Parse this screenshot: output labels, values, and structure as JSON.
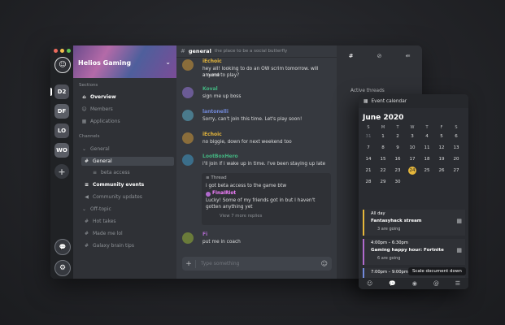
{
  "window": {
    "dots": [
      "#ed6a5e",
      "#f4bf4f",
      "#61c554"
    ]
  },
  "rail": {
    "servers": [
      {
        "initials": "D2"
      },
      {
        "initials": "DF"
      },
      {
        "initials": "LO"
      },
      {
        "initials": "WO"
      }
    ],
    "add": "+",
    "chat": "💬",
    "settings": "⚙"
  },
  "sidebar": {
    "guild_name": "Helios Gaming",
    "sections_title": "Sections",
    "sections": [
      {
        "label": "Overview",
        "icon": "⌂"
      },
      {
        "label": "Members",
        "icon": "☺"
      },
      {
        "label": "Applications",
        "icon": "▦"
      }
    ],
    "channels_title": "Channels",
    "general_category": "General",
    "channels_general": [
      {
        "label": "General",
        "icon": "#"
      },
      {
        "label": "beta access",
        "icon": "≡"
      },
      {
        "label": "Community events",
        "icon": "≡"
      },
      {
        "label": "Community updates",
        "icon": "◀"
      }
    ],
    "offtopic_category": "Off-topic",
    "channels_offtopic": [
      {
        "label": "Hot takes",
        "icon": "#"
      },
      {
        "label": "Made me lol",
        "icon": "#"
      },
      {
        "label": "Galaxy brain tips",
        "icon": "#"
      }
    ]
  },
  "main": {
    "channel": "general",
    "topic": "the place to be a social butterfly",
    "messages": [
      {
        "name": "iEchoic",
        "color": "#e6b73b",
        "text": [
          "hey all! looking to do an OW scrim tomorrow. will anyone",
          "around to play?"
        ]
      },
      {
        "name": "Koval",
        "color": "#43b581",
        "text": [
          "sign me up boss"
        ]
      },
      {
        "name": "lantonelli",
        "color": "#7289da",
        "text": [
          "Sorry, can't join this time. Let's play soon!"
        ]
      },
      {
        "name": "iEchoic",
        "color": "#e6b73b",
        "text": [
          "no biggie, down for next weekend too"
        ]
      },
      {
        "name": "LootBoxHero",
        "color": "#43b581",
        "text": [
          "i'll join if i wake up in time. i've been staying up late"
        ]
      }
    ],
    "thread": {
      "label": "Thread",
      "lines": [
        "i got beta access to the game btw"
      ],
      "reply_name": "FinalRiot",
      "reply_text": [
        "Lucky! Some of my friends got in but I haven't",
        "gotten anything yet"
      ],
      "more": "View 7 more replies"
    },
    "last": {
      "name": "Fi",
      "text": "put me in coach"
    },
    "composer_placeholder": "Type something"
  },
  "right": {
    "tabs": [
      "#",
      "⊘",
      "⇚"
    ],
    "active_threads_title": "Active threads"
  },
  "calendar": {
    "header": "Event calendar",
    "month": "June 2020",
    "dow": [
      "S",
      "M",
      "T",
      "W",
      "T",
      "F",
      "S"
    ],
    "weeks": [
      [
        "31",
        "1",
        "2",
        "3",
        "4",
        "5",
        "6"
      ],
      [
        "7",
        "8",
        "9",
        "10",
        "11",
        "12",
        "13"
      ],
      [
        "14",
        "15",
        "16",
        "17",
        "18",
        "19",
        "20"
      ],
      [
        "21",
        "22",
        "23",
        "24",
        "25",
        "26",
        "27"
      ],
      [
        "28",
        "29",
        "30",
        "",
        "",
        "",
        ""
      ]
    ],
    "today": "24",
    "events": [
      {
        "time": "All day",
        "title": "Fantasyhack stream",
        "going": "3 are going",
        "color": "#e6b73b"
      },
      {
        "time": "4:00pm – 6:30pm",
        "title": "Gaming happy hour: Fortnite",
        "going": "6 are going",
        "color": "#b06acd"
      },
      {
        "time": "7:00pm – 9:00pm",
        "title": "",
        "going": "",
        "color": "#7289da"
      }
    ],
    "tabs": [
      "☺",
      "💬",
      "◉",
      "@",
      "☰"
    ]
  },
  "tooltip": "Scale document down"
}
